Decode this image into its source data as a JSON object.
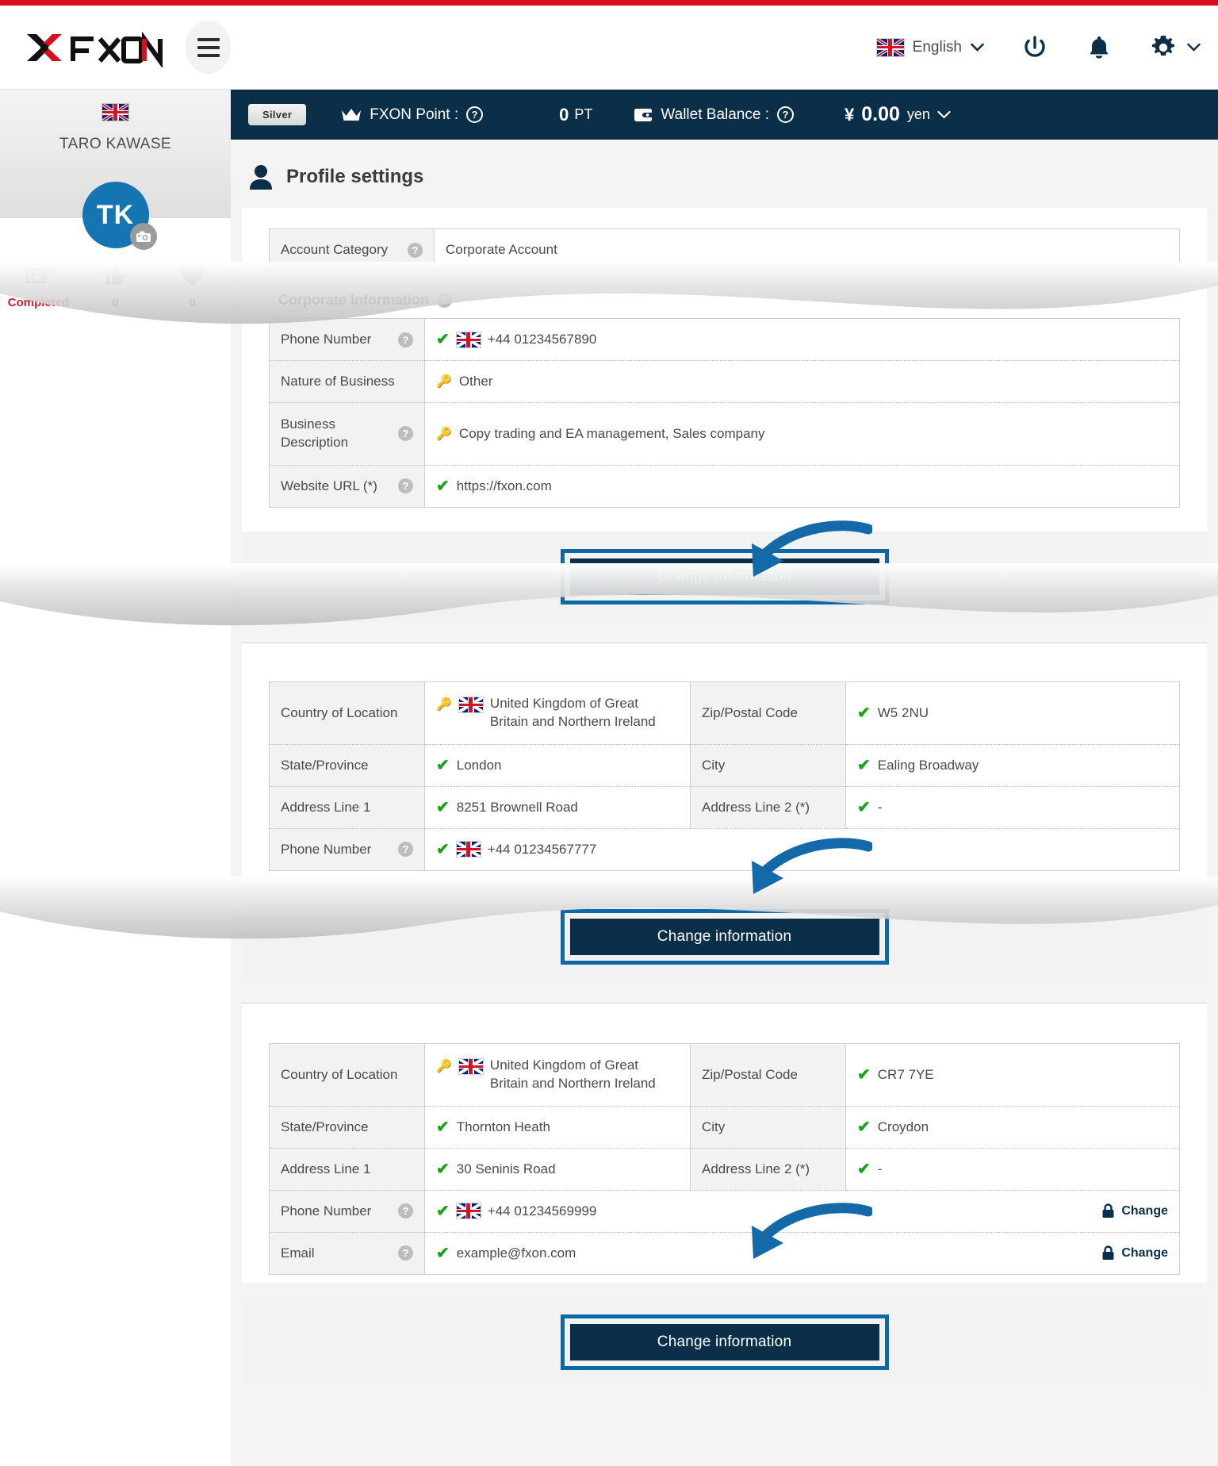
{
  "header": {
    "logo_text": "FXON",
    "menu_icon": "hamburger-menu-icon",
    "language": "English",
    "language_flag": "uk-flag-icon",
    "power_icon": "power-icon",
    "bell_icon": "notification-bell-icon",
    "gear_icon": "settings-gear-icon"
  },
  "statusbar": {
    "rank_badge": "Silver",
    "point_label": "FXON Point :",
    "point_value": "0",
    "point_unit": "PT",
    "wallet_label": "Wallet Balance :",
    "wallet_symbol": "¥",
    "wallet_value": "0.00",
    "wallet_currency": "yen"
  },
  "sidebar": {
    "country_flag": "uk-flag-icon",
    "user_name": "TARO KAWASE",
    "avatar_initials": "TK",
    "camera_icon": "camera-icon",
    "stats": [
      {
        "icon": "id-card-verified-icon",
        "value": "Completed"
      },
      {
        "icon": "thumbs-up-icon",
        "value": "0"
      },
      {
        "icon": "heart-icon",
        "value": "0"
      }
    ]
  },
  "main": {
    "page_title": "Profile settings",
    "page_title_icon": "user-icon",
    "account_category_label": "Account Category",
    "account_category_value": "Corporate Account",
    "corporate_section_title": "Corporate Information",
    "corporate_rows": [
      {
        "label": "Phone Number",
        "help": true,
        "status": "check",
        "flag": true,
        "value": "+44 01234567890"
      },
      {
        "label": "Nature of Business",
        "help": false,
        "status": "key",
        "flag": false,
        "value": "Other"
      },
      {
        "label": "Business Description",
        "help": true,
        "status": "key",
        "flag": false,
        "value": "Copy trading and EA management, Sales company"
      },
      {
        "label": "Website URL (*)",
        "help": true,
        "status": "check",
        "flag": false,
        "value": "https://fxon.com"
      }
    ],
    "change_button_label": "Change information",
    "address_rows_1": [
      {
        "label": "Country of Location",
        "status": "key",
        "flag": true,
        "value": "United Kingdom of Great Britain and Northern Ireland",
        "label2": "Zip/Postal Code",
        "status2": "check",
        "value2": "W5 2NU"
      },
      {
        "label": "State/Province",
        "status": "check",
        "flag": false,
        "value": "London",
        "label2": "City",
        "status2": "check",
        "value2": "Ealing Broadway"
      },
      {
        "label": "Address Line 1",
        "status": "check",
        "flag": false,
        "value": "8251 Brownell Road",
        "label2": "Address Line 2 (*)",
        "status2": "check",
        "value2": "-"
      }
    ],
    "address_phone_1": {
      "label": "Phone Number",
      "help": true,
      "status": "check",
      "flag": true,
      "value": "+44 01234567777"
    },
    "address_rows_2": [
      {
        "label": "Country of Location",
        "status": "key",
        "flag": true,
        "value": "United Kingdom of Great Britain and Northern Ireland",
        "label2": "Zip/Postal Code",
        "status2": "check",
        "value2": "CR7 7YE"
      },
      {
        "label": "State/Province",
        "status": "check",
        "flag": false,
        "value": "Thornton Heath",
        "label2": "City",
        "status2": "check",
        "value2": "Croydon"
      },
      {
        "label": "Address Line 1",
        "status": "check",
        "flag": false,
        "value": "30 Seninis Road",
        "label2": "Address Line 2 (*)",
        "status2": "check",
        "value2": "-"
      }
    ],
    "contact_rows": [
      {
        "label": "Phone Number",
        "help": true,
        "status": "check",
        "flag": true,
        "value": "+44 01234569999",
        "action": "Change"
      },
      {
        "label": "Email",
        "help": true,
        "status": "check",
        "flag": false,
        "value": "example@fxon.com",
        "action": "Change"
      }
    ]
  },
  "colors": {
    "brand_dark": "#0b2e49",
    "brand_red": "#d80e1e",
    "accent_blue": "#0b69a8",
    "check_green": "#19a319",
    "avatar_blue": "#1574b2"
  }
}
